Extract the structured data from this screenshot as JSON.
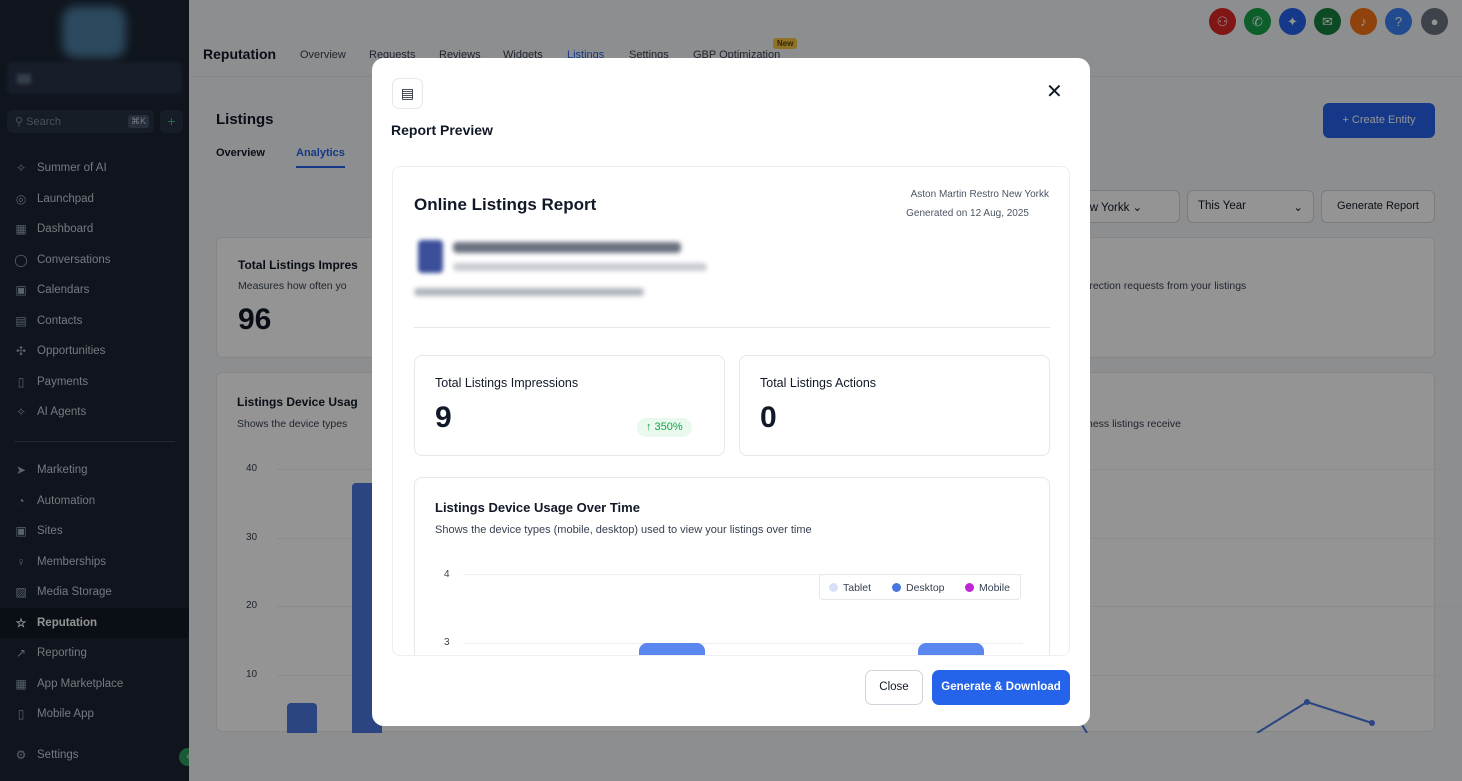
{
  "sidebar": {
    "search_placeholder": "Search",
    "search_shortcut": "⌘K",
    "items": [
      {
        "label": "Summer of AI",
        "icon": "sparkle-icon"
      },
      {
        "label": "Launchpad",
        "icon": "rocket-icon"
      },
      {
        "label": "Dashboard",
        "icon": "grid-icon"
      },
      {
        "label": "Conversations",
        "icon": "chat-icon"
      },
      {
        "label": "Calendars",
        "icon": "calendar-icon"
      },
      {
        "label": "Contacts",
        "icon": "contacts-icon"
      },
      {
        "label": "Opportunities",
        "icon": "opportunities-icon"
      },
      {
        "label": "Payments",
        "icon": "receipt-icon"
      },
      {
        "label": "AI Agents",
        "icon": "sparkle-icon"
      },
      {
        "label": "Marketing",
        "icon": "send-icon"
      },
      {
        "label": "Automation",
        "icon": "automation-icon"
      },
      {
        "label": "Sites",
        "icon": "sites-icon"
      },
      {
        "label": "Memberships",
        "icon": "membership-icon"
      },
      {
        "label": "Media Storage",
        "icon": "image-icon"
      },
      {
        "label": "Reputation",
        "icon": "star-icon"
      },
      {
        "label": "Reporting",
        "icon": "trend-icon"
      },
      {
        "label": "App Marketplace",
        "icon": "apps-icon"
      },
      {
        "label": "Mobile App",
        "icon": "mobile-icon"
      },
      {
        "label": "Settings",
        "icon": "gear-icon"
      }
    ],
    "active_item": "Reputation"
  },
  "header": {
    "section_title": "Reputation",
    "tabs": [
      "Overview",
      "Requests",
      "Reviews",
      "Widgets",
      "Listings",
      "Settings",
      "GBP Optimization"
    ],
    "active_tab": "Listings",
    "new_badge": "New",
    "icons": [
      {
        "name": "dial-icon",
        "color": "#dc2626"
      },
      {
        "name": "phone-icon",
        "color": "#16a34a"
      },
      {
        "name": "magic-icon",
        "color": "#2563eb"
      },
      {
        "name": "megaphone-icon",
        "color": "#15803d"
      },
      {
        "name": "bell-icon",
        "color": "#f97316"
      },
      {
        "name": "help-icon",
        "color": "#3b82f6"
      },
      {
        "name": "avatar",
        "color": "#6b7280"
      }
    ]
  },
  "page": {
    "title": "Listings",
    "tabs": [
      "Overview",
      "Analytics"
    ],
    "active_tab": "Analytics",
    "create_button": "+  Create Entity",
    "location_filter": "New Yorkk",
    "period_filter": "This Year",
    "generate_report_button": "Generate Report",
    "impressions_card": {
      "title": "Total Listings Impres",
      "desc": "Measures how often yo",
      "value": "96"
    },
    "actions_card_desc": "irection requests from your listings",
    "device_card": {
      "title": "Listings Device Usag",
      "desc": "Shows the device types",
      "right_desc": "ness listings receive"
    },
    "y_ticks": [
      "40",
      "30",
      "20",
      "10"
    ]
  },
  "modal": {
    "title": "Report Preview",
    "close_glyph": "✕",
    "report_title": "Online Listings Report",
    "business_name": "Aston Martin Restro New Yorkk",
    "generated_on": "Generated on 12 Aug, 2025",
    "stats": [
      {
        "title": "Total Listings Impressions",
        "value": "9",
        "change": "↑ 350%"
      },
      {
        "title": "Total Listings Actions",
        "value": "0"
      }
    ],
    "device_chart": {
      "title": "Listings Device Usage Over Time",
      "description": "Shows the device types (mobile, desktop) used to view your listings over time",
      "y_ticks": [
        "4",
        "3"
      ]
    },
    "legend": [
      {
        "label": "Tablet",
        "color": "#d6e0fb"
      },
      {
        "label": "Desktop",
        "color": "#4a76e0"
      },
      {
        "label": "Mobile",
        "color": "#c026d3"
      }
    ],
    "close_button": "Close",
    "generate_button": "Generate & Download"
  }
}
